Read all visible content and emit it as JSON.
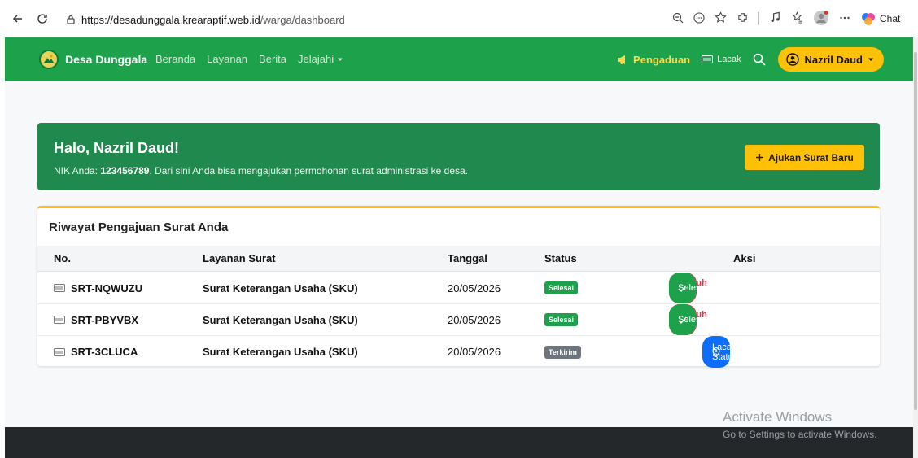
{
  "browser": {
    "url_host": "https://desadunggala.krearaptif.web.id",
    "url_path": "/warga/dashboard",
    "chat_label": "Chat"
  },
  "navbar": {
    "brand": "Desa Dunggala",
    "menu": [
      "Beranda",
      "Layanan",
      "Berita",
      "Jelajahi"
    ],
    "complaint": "Pengaduan",
    "track": "Lacak",
    "user": "Nazril Daud"
  },
  "hero": {
    "greeting": "Halo, Nazril Daud!",
    "nik_prefix": "NIK Anda: ",
    "nik": "123456789",
    "nik_suffix": ". Dari sini Anda bisa mengajukan permohonan surat administrasi ke desa.",
    "new_button": "Ajukan Surat Baru"
  },
  "history": {
    "title": "Riwayat Pengajuan Surat Anda",
    "headers": [
      "No.",
      "Layanan Surat",
      "Tanggal",
      "Status",
      "Aksi"
    ],
    "rows": [
      {
        "no": "SRT-NQWUZU",
        "service": "Surat Keterangan Usaha (SKU)",
        "date": "20/05/2026",
        "status": "Selesai",
        "pdf": "Unduh PDF",
        "done": "Selesai"
      },
      {
        "no": "SRT-PBYVBX",
        "service": "Surat Keterangan Usaha (SKU)",
        "date": "20/05/2026",
        "status": "Selesai",
        "pdf": "Unduh PDF",
        "done": "Selesai"
      },
      {
        "no": "SRT-3CLUCA",
        "service": "Surat Keterangan Usaha (SKU)",
        "date": "20/05/2026",
        "status": "Terkirim",
        "track": "Lacak Status"
      }
    ]
  },
  "watermark": {
    "line1": "Activate Windows",
    "line2": "Go to Settings to activate Windows."
  },
  "colors": {
    "primary_green": "#1ea14b",
    "hero_green": "#208a4e",
    "accent_yellow": "#ffc107",
    "danger_red": "#dc3545",
    "info_blue": "#0d6efd",
    "footer_dark": "#25282b"
  }
}
